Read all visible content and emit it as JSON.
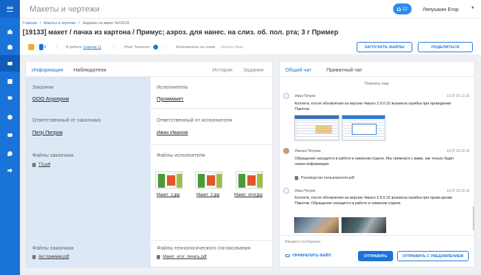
{
  "app": {
    "title": "Макеты и чертежи"
  },
  "topbar": {
    "notif_count": "12",
    "user_name": "Ляпушкин Егор"
  },
  "breadcrumb": [
    "Главная",
    "Макеты и чертежи",
    "Задание на макет №19133"
  ],
  "page_title": "[19133] макет / пачка из картона / Примус; аэроз. для нанес. на слиз. об. пол. рта; 3 г Пример",
  "status": {
    "counter": "8",
    "work_label": "В работе",
    "work_link": "(оценка 1)",
    "stage_label": "Этап: Технолог",
    "executor_label": "Исполнитель на этапе:",
    "executor_value": "Иванов Иван"
  },
  "buttons": {
    "upload": "ЗАГРУЗИТЬ ФАЙЛЫ",
    "share": "ПОДЕЛИТЬСЯ"
  },
  "left_tabs": [
    "Информация",
    "Наблюдатели",
    "История",
    "Задание"
  ],
  "customer": {
    "label": "Заказчик",
    "value": "ООО Агропром"
  },
  "executor": {
    "label": "Исполнитель",
    "value": "Проммакет"
  },
  "resp_customer": {
    "label": "Ответственный от заказчика",
    "value": "Петр Петров"
  },
  "resp_executor": {
    "label": "Ответственный от исполнителя",
    "value": "Иван Иванов"
  },
  "customer_files": {
    "label": "Файлы заказчика",
    "files": [
      "ТЗ.pdf"
    ]
  },
  "executor_files": {
    "label": "Файлы исполнителя",
    "files": [
      "Макет_1.jpg",
      "Макет_2.jpg",
      "Макет_итог.jpg"
    ]
  },
  "customer_files2": {
    "label": "Файлы заказчика",
    "files": [
      "Акт приемки.pdf"
    ]
  },
  "tech_files": {
    "label": "Файлы технологического согласования",
    "files": [
      "Макет_итог_печать.pdf"
    ]
  },
  "chat": {
    "tabs": [
      "Общий чат",
      "Приватный чат"
    ],
    "load_more": "Показать еще",
    "messages": [
      {
        "name": "Иван Петров",
        "time": "13:37 02.12.16",
        "text": "Коллеги, после обновления на версию Чикаго 2.9.0.15 возникла ошибка при проведении Пакетов"
      },
      {
        "name": "Иванка Петрова",
        "time": "13:37 02.12.16",
        "text": "Обращение находится в работе в смежном отделе. Мы свяжемся с вами, как только будет новая информация.",
        "file": "Руководство пользователя.pdf"
      },
      {
        "name": "Иван Петров",
        "time": "13:37 02.12.16",
        "text": "Коллеги, после обновления на версию Чикаго 2.9.0.15 возникла ошибка при прове-дении Пакетов. Обращение находится в работе в смежном отделе."
      }
    ],
    "input_placeholder": "Введите сообщение",
    "attach_label": "ПРИКРЕПИТЬ ФАЙЛ",
    "send_label": "ОТПРАВИТЬ",
    "send_notify_label": "ОТПРАВИТЬ С УВЕДОМЛЕНИЕМ"
  },
  "colors": {
    "accent": "#1a73d8",
    "sidebar": "#1a73d8",
    "highlight": "#dde8f6"
  },
  "sidebar_icons": [
    "menu-icon",
    "home-icon",
    "user-icon",
    "mail-icon",
    "book-icon",
    "cart-icon",
    "gear-icon",
    "briefcase-icon",
    "chat-icon",
    "exit-icon"
  ]
}
